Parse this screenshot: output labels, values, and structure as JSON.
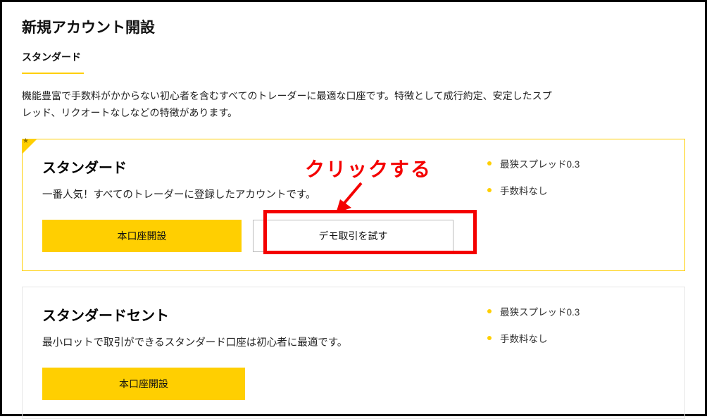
{
  "page": {
    "title": "新規アカウント開設",
    "subtitle": "スタンダード",
    "description": "機能豊富で手数料がかからない初心者を含むすべてのトレーダーに最適な口座です。特徴として成行約定、安定したスプレッド、リクオートなしなどの特徴があります。"
  },
  "cards": {
    "standard": {
      "title": "スタンダード",
      "desc": "一番人気！すべてのトレーダーに登録したアカウントです。",
      "primary_btn": "本口座開設",
      "secondary_btn": "デモ取引を試す",
      "features": [
        "最狭スプレッド0.3",
        "手数料なし"
      ]
    },
    "cent": {
      "title": "スタンダードセント",
      "desc": "最小ロットで取引ができるスタンダード口座は初心者に最適です。",
      "primary_btn": "本口座開設",
      "features": [
        "最狭スプレッド0.3",
        "手数料なし"
      ]
    }
  },
  "annotation": {
    "text": "クリックする"
  }
}
